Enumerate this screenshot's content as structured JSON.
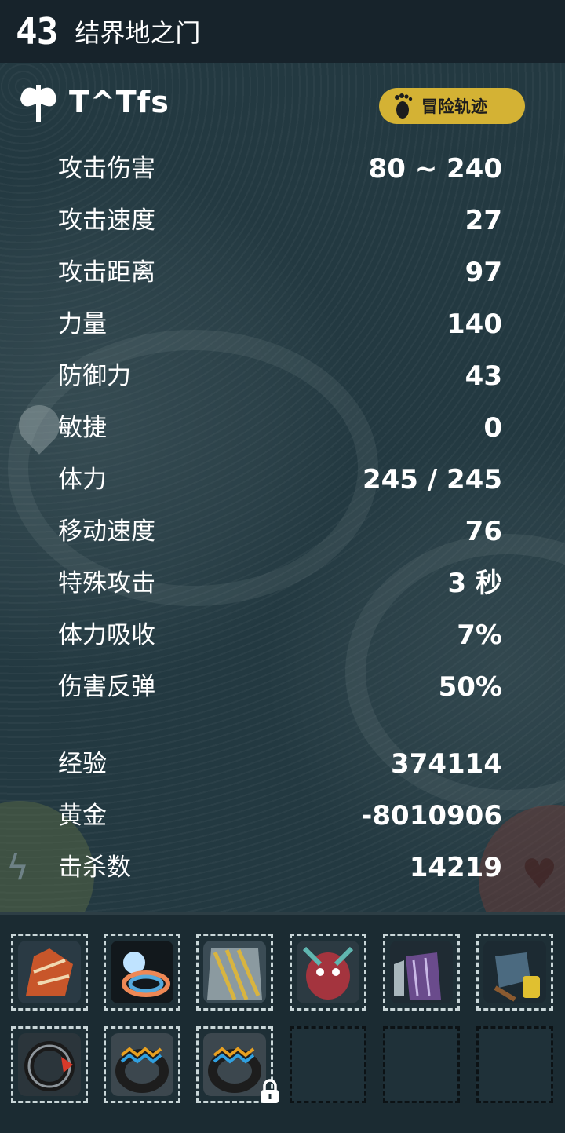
{
  "header": {
    "level": "43",
    "map_name": "结界地之门"
  },
  "player": {
    "name": "T^Tfs",
    "trail_button": "冒险轨迹"
  },
  "stats": [
    {
      "label": "攻击伤害",
      "value": "80 ~ 240"
    },
    {
      "label": "攻击速度",
      "value": "27"
    },
    {
      "label": "攻击距离",
      "value": "97"
    },
    {
      "label": "力量",
      "value": "140"
    },
    {
      "label": "防御力",
      "value": "43"
    },
    {
      "label": "敏捷",
      "value": "0"
    },
    {
      "label": "体力",
      "value": "245 / 245"
    },
    {
      "label": "移动速度",
      "value": "76"
    },
    {
      "label": "特殊攻击",
      "value": "3 秒"
    },
    {
      "label": "体力吸收",
      "value": "7%"
    },
    {
      "label": "伤害反弹",
      "value": "50%"
    }
  ],
  "progress": [
    {
      "label": "经验",
      "value": "374114"
    },
    {
      "label": "黄金",
      "value": "-8010906"
    },
    {
      "label": "击杀数",
      "value": "14219"
    }
  ],
  "inventory": {
    "slots": [
      {
        "item": "orange-claw-weapon",
        "color": "#c8562a"
      },
      {
        "item": "glowing-orb-ring",
        "color": "#6b7d9a"
      },
      {
        "item": "striped-cape",
        "color": "#8b9aa0"
      },
      {
        "item": "red-demon-mask",
        "color": "#a4343e"
      },
      {
        "item": "purple-armor",
        "color": "#6a4b8c"
      },
      {
        "item": "gauntlet",
        "color": "#4b6a80"
      },
      {
        "item": "dark-ring",
        "color": "#3a3e44"
      },
      {
        "item": "rainbow-ring",
        "color": "#4a5a64"
      },
      {
        "item": "rainbow-ring",
        "color": "#4a5a64"
      },
      {
        "item": "empty"
      },
      {
        "item": "empty"
      },
      {
        "item": "empty"
      }
    ],
    "locked_icon": "lock-icon"
  }
}
